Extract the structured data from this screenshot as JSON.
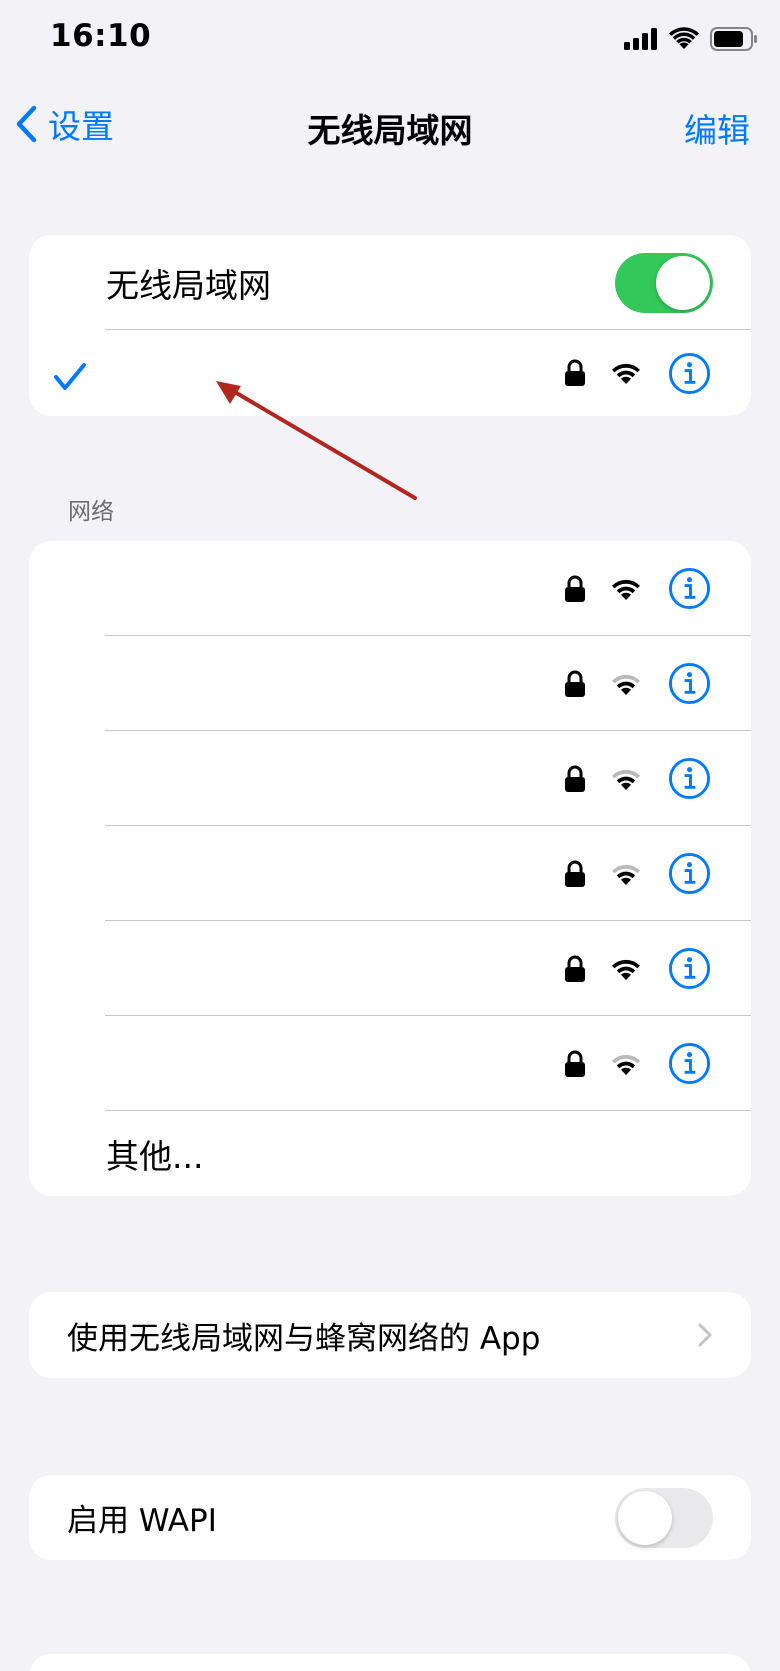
{
  "status_bar": {
    "time": "16:10"
  },
  "nav": {
    "back_label": "设置",
    "title": "无线局域网",
    "edit_label": "编辑"
  },
  "wifi_card": {
    "toggle_label": "无线局域网",
    "toggle_on": true,
    "connected_network_name": ""
  },
  "networks_section": {
    "header": "网络",
    "networks": [
      {
        "name": "",
        "locked": true,
        "signal": 3
      },
      {
        "name": "",
        "locked": true,
        "signal": 2
      },
      {
        "name": "",
        "locked": true,
        "signal": 2
      },
      {
        "name": "",
        "locked": true,
        "signal": 2
      },
      {
        "name": "",
        "locked": true,
        "signal": 3
      },
      {
        "name": "",
        "locked": true,
        "signal": 2
      }
    ],
    "other_label": "其他..."
  },
  "apps_row": {
    "label": "使用无线局域网与蜂窝网络的 App"
  },
  "wapi_row": {
    "label": "启用 WAPI",
    "toggle_on": false
  },
  "colors": {
    "accent": "#007aff",
    "toggle_on": "#34c759",
    "annotation_arrow": "#b3261e",
    "background": "#f2f2f7"
  }
}
